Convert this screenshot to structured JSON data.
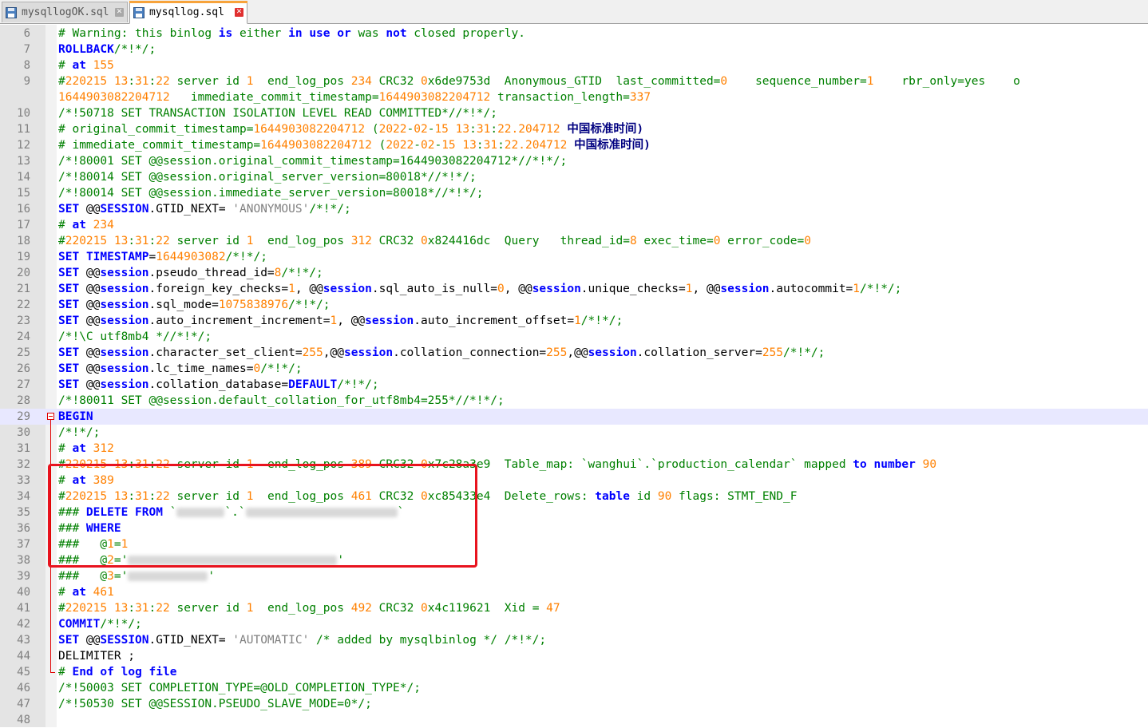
{
  "tabs": [
    {
      "label": "mysqllogOK.sql",
      "close": "✕",
      "active": false
    },
    {
      "label": "mysqllog.sql",
      "close": "✕",
      "active": true
    }
  ],
  "lines": [
    {
      "n": "6",
      "t": [
        [
          "# Warning: this binlog ",
          "cm"
        ],
        [
          "is",
          "kw"
        ],
        [
          " either ",
          "cm"
        ],
        [
          "in",
          "kw"
        ],
        [
          " ",
          "cm"
        ],
        [
          "use",
          "kw"
        ],
        [
          " ",
          "cm"
        ],
        [
          "or",
          "kw"
        ],
        [
          " was ",
          "cm"
        ],
        [
          "not",
          "kw"
        ],
        [
          " closed properly.",
          "cm"
        ]
      ]
    },
    {
      "n": "7",
      "t": [
        [
          "ROLLBACK",
          "kw"
        ],
        [
          "/*!*/;",
          "cm"
        ]
      ]
    },
    {
      "n": "8",
      "t": [
        [
          "# ",
          "cm"
        ],
        [
          "at",
          "kw"
        ],
        [
          " ",
          "cm"
        ],
        [
          "155",
          "num"
        ]
      ]
    },
    {
      "n": "9",
      "t": [
        [
          "#",
          "cm"
        ],
        [
          "220215",
          "num"
        ],
        [
          " ",
          "cm"
        ],
        [
          "13",
          "num"
        ],
        [
          ":",
          "cm"
        ],
        [
          "31",
          "num"
        ],
        [
          ":",
          "cm"
        ],
        [
          "22",
          "num"
        ],
        [
          " server id ",
          "cm"
        ],
        [
          "1",
          "num"
        ],
        [
          "  end_log_pos ",
          "cm"
        ],
        [
          "234",
          "num"
        ],
        [
          " CRC32 ",
          "cm"
        ],
        [
          "0",
          "num"
        ],
        [
          "x6de9753d  Anonymous_GTID  last_committed=",
          "cm"
        ],
        [
          "0",
          "num"
        ],
        [
          "    sequence_number=",
          "cm"
        ],
        [
          "1",
          "num"
        ],
        [
          "    rbr_only=yes    o",
          "cm"
        ]
      ]
    },
    {
      "n": "",
      "t": [
        [
          "1644903082204712",
          "num"
        ],
        [
          "   immediate_commit_timestamp=",
          "cm"
        ],
        [
          "1644903082204712",
          "num"
        ],
        [
          " transaction_length=",
          "cm"
        ],
        [
          "337",
          "num"
        ]
      ]
    },
    {
      "n": "10",
      "t": [
        [
          "/*!50718 SET TRANSACTION ISOLATION LEVEL READ COMMITTED*//*!*/;",
          "cm"
        ]
      ]
    },
    {
      "n": "11",
      "t": [
        [
          "# original_commit_timestamp=",
          "cm"
        ],
        [
          "1644903082204712",
          "num"
        ],
        [
          " (",
          "cm"
        ],
        [
          "2022",
          "num"
        ],
        [
          "-",
          "cm"
        ],
        [
          "02",
          "num"
        ],
        [
          "-",
          "cm"
        ],
        [
          "15",
          "num"
        ],
        [
          " ",
          "cm"
        ],
        [
          "13",
          "num"
        ],
        [
          ":",
          "cm"
        ],
        [
          "31",
          "num"
        ],
        [
          ":",
          "cm"
        ],
        [
          "22.204712",
          "num"
        ],
        [
          " 中国标准时间)",
          "op"
        ]
      ]
    },
    {
      "n": "12",
      "t": [
        [
          "# immediate_commit_timestamp=",
          "cm"
        ],
        [
          "1644903082204712",
          "num"
        ],
        [
          " (",
          "cm"
        ],
        [
          "2022",
          "num"
        ],
        [
          "-",
          "cm"
        ],
        [
          "02",
          "num"
        ],
        [
          "-",
          "cm"
        ],
        [
          "15",
          "num"
        ],
        [
          " ",
          "cm"
        ],
        [
          "13",
          "num"
        ],
        [
          ":",
          "cm"
        ],
        [
          "31",
          "num"
        ],
        [
          ":",
          "cm"
        ],
        [
          "22.204712",
          "num"
        ],
        [
          " 中国标准时间)",
          "op"
        ]
      ]
    },
    {
      "n": "13",
      "t": [
        [
          "/*!80001 SET @@session.original_commit_timestamp=1644903082204712*//*!*/;",
          "cm"
        ]
      ]
    },
    {
      "n": "14",
      "t": [
        [
          "/*!80014 SET @@session.original_server_version=80018*//*!*/;",
          "cm"
        ]
      ]
    },
    {
      "n": "15",
      "t": [
        [
          "/*!80014 SET @@session.immediate_server_version=80018*//*!*/;",
          "cm"
        ]
      ]
    },
    {
      "n": "16",
      "t": [
        [
          "SET",
          "kw"
        ],
        [
          " @@",
          ""
        ],
        [
          "SESSION",
          "kw"
        ],
        [
          ".GTID_NEXT= ",
          ""
        ],
        [
          "'ANONYMOUS'",
          "str"
        ],
        [
          "/*!*/;",
          "cm"
        ]
      ]
    },
    {
      "n": "17",
      "t": [
        [
          "# ",
          "cm"
        ],
        [
          "at",
          "kw"
        ],
        [
          " ",
          "cm"
        ],
        [
          "234",
          "num"
        ]
      ]
    },
    {
      "n": "18",
      "t": [
        [
          "#",
          "cm"
        ],
        [
          "220215",
          "num"
        ],
        [
          " ",
          "cm"
        ],
        [
          "13",
          "num"
        ],
        [
          ":",
          "cm"
        ],
        [
          "31",
          "num"
        ],
        [
          ":",
          "cm"
        ],
        [
          "22",
          "num"
        ],
        [
          " server id ",
          "cm"
        ],
        [
          "1",
          "num"
        ],
        [
          "  end_log_pos ",
          "cm"
        ],
        [
          "312",
          "num"
        ],
        [
          " CRC32 ",
          "cm"
        ],
        [
          "0",
          "num"
        ],
        [
          "x824416dc  Query   thread_id=",
          "cm"
        ],
        [
          "8",
          "num"
        ],
        [
          " exec_time=",
          "cm"
        ],
        [
          "0",
          "num"
        ],
        [
          " error_code=",
          "cm"
        ],
        [
          "0",
          "num"
        ]
      ]
    },
    {
      "n": "19",
      "t": [
        [
          "SET",
          "kw"
        ],
        [
          " ",
          ""
        ],
        [
          "TIMESTAMP",
          "kw"
        ],
        [
          "=",
          ""
        ],
        [
          "1644903082",
          "num"
        ],
        [
          "/*!*/;",
          "cm"
        ]
      ]
    },
    {
      "n": "20",
      "t": [
        [
          "SET",
          "kw"
        ],
        [
          " @@",
          ""
        ],
        [
          "session",
          "kw"
        ],
        [
          ".pseudo_thread_id=",
          ""
        ],
        [
          "8",
          "num"
        ],
        [
          "/*!*/;",
          "cm"
        ]
      ]
    },
    {
      "n": "21",
      "t": [
        [
          "SET",
          "kw"
        ],
        [
          " @@",
          ""
        ],
        [
          "session",
          "kw"
        ],
        [
          ".foreign_key_checks=",
          ""
        ],
        [
          "1",
          "num"
        ],
        [
          ", @@",
          ""
        ],
        [
          "session",
          "kw"
        ],
        [
          ".sql_auto_is_null=",
          ""
        ],
        [
          "0",
          "num"
        ],
        [
          ", @@",
          ""
        ],
        [
          "session",
          "kw"
        ],
        [
          ".unique_checks=",
          ""
        ],
        [
          "1",
          "num"
        ],
        [
          ", @@",
          ""
        ],
        [
          "session",
          "kw"
        ],
        [
          ".autocommit=",
          ""
        ],
        [
          "1",
          "num"
        ],
        [
          "/*!*/;",
          "cm"
        ]
      ]
    },
    {
      "n": "22",
      "t": [
        [
          "SET",
          "kw"
        ],
        [
          " @@",
          ""
        ],
        [
          "session",
          "kw"
        ],
        [
          ".sql_mode=",
          ""
        ],
        [
          "1075838976",
          "num"
        ],
        [
          "/*!*/;",
          "cm"
        ]
      ]
    },
    {
      "n": "23",
      "t": [
        [
          "SET",
          "kw"
        ],
        [
          " @@",
          ""
        ],
        [
          "session",
          "kw"
        ],
        [
          ".auto_increment_increment=",
          ""
        ],
        [
          "1",
          "num"
        ],
        [
          ", @@",
          ""
        ],
        [
          "session",
          "kw"
        ],
        [
          ".auto_increment_offset=",
          ""
        ],
        [
          "1",
          "num"
        ],
        [
          "/*!*/;",
          "cm"
        ]
      ]
    },
    {
      "n": "24",
      "t": [
        [
          "/*!\\C utf8mb4 *//*!*/;",
          "cm"
        ]
      ]
    },
    {
      "n": "25",
      "t": [
        [
          "SET",
          "kw"
        ],
        [
          " @@",
          ""
        ],
        [
          "session",
          "kw"
        ],
        [
          ".character_set_client=",
          ""
        ],
        [
          "255",
          "num"
        ],
        [
          ",@@",
          ""
        ],
        [
          "session",
          "kw"
        ],
        [
          ".collation_connection=",
          ""
        ],
        [
          "255",
          "num"
        ],
        [
          ",@@",
          ""
        ],
        [
          "session",
          "kw"
        ],
        [
          ".collation_server=",
          ""
        ],
        [
          "255",
          "num"
        ],
        [
          "/*!*/;",
          "cm"
        ]
      ]
    },
    {
      "n": "26",
      "t": [
        [
          "SET",
          "kw"
        ],
        [
          " @@",
          ""
        ],
        [
          "session",
          "kw"
        ],
        [
          ".lc_time_names=",
          ""
        ],
        [
          "0",
          "num"
        ],
        [
          "/*!*/;",
          "cm"
        ]
      ]
    },
    {
      "n": "27",
      "t": [
        [
          "SET",
          "kw"
        ],
        [
          " @@",
          ""
        ],
        [
          "session",
          "kw"
        ],
        [
          ".collation_database=",
          ""
        ],
        [
          "DEFAULT",
          "kw"
        ],
        [
          "/*!*/;",
          "cm"
        ]
      ]
    },
    {
      "n": "28",
      "t": [
        [
          "/*!80011 SET @@session.default_collation_for_utf8mb4=255*//*!*/;",
          "cm"
        ]
      ]
    },
    {
      "n": "29",
      "t": [
        [
          "BEGIN",
          "kw"
        ]
      ]
    },
    {
      "n": "30",
      "t": [
        [
          "/*!*/;",
          "cm"
        ]
      ]
    },
    {
      "n": "31",
      "t": [
        [
          "# ",
          "cm"
        ],
        [
          "at",
          "kw"
        ],
        [
          " ",
          "cm"
        ],
        [
          "312",
          "num"
        ]
      ]
    },
    {
      "n": "32",
      "t": [
        [
          "#",
          "cm"
        ],
        [
          "220215",
          "num"
        ],
        [
          " ",
          "cm"
        ],
        [
          "13",
          "num"
        ],
        [
          ":",
          "cm"
        ],
        [
          "31",
          "num"
        ],
        [
          ":",
          "cm"
        ],
        [
          "22",
          "num"
        ],
        [
          " server id ",
          "cm"
        ],
        [
          "1",
          "num"
        ],
        [
          "  end_log_pos ",
          "cm"
        ],
        [
          "389",
          "num"
        ],
        [
          " CRC32 ",
          "cm"
        ],
        [
          "0",
          "num"
        ],
        [
          "x7c28a3e9  Table_map: `wanghui`.`production_calendar` mapped ",
          "cm"
        ],
        [
          "to",
          "kw"
        ],
        [
          " ",
          "cm"
        ],
        [
          "number",
          "kw"
        ],
        [
          " ",
          "cm"
        ],
        [
          "90",
          "num"
        ]
      ]
    },
    {
      "n": "33",
      "t": [
        [
          "# ",
          "cm"
        ],
        [
          "at",
          "kw"
        ],
        [
          " ",
          "cm"
        ],
        [
          "389",
          "num"
        ]
      ]
    },
    {
      "n": "34",
      "t": [
        [
          "#",
          "cm"
        ],
        [
          "220215",
          "num"
        ],
        [
          " ",
          "cm"
        ],
        [
          "13",
          "num"
        ],
        [
          ":",
          "cm"
        ],
        [
          "31",
          "num"
        ],
        [
          ":",
          "cm"
        ],
        [
          "22",
          "num"
        ],
        [
          " server id ",
          "cm"
        ],
        [
          "1",
          "num"
        ],
        [
          "  end_log_pos ",
          "cm"
        ],
        [
          "461",
          "num"
        ],
        [
          " CRC32 ",
          "cm"
        ],
        [
          "0",
          "num"
        ],
        [
          "xc85433e4  Delete_rows: ",
          "cm"
        ],
        [
          "table",
          "kw"
        ],
        [
          " id ",
          "cm"
        ],
        [
          "90",
          "num"
        ],
        [
          " flags: STMT_END_F",
          "cm"
        ]
      ]
    },
    {
      "n": "35",
      "t": [
        [
          "### ",
          "cm"
        ],
        [
          "DELETE",
          "kw"
        ],
        [
          " ",
          "cm"
        ],
        [
          "FROM",
          "kw"
        ],
        [
          " `",
          "cm"
        ],
        [
          "#60",
          "R"
        ],
        [
          "`.`",
          "cm"
        ],
        [
          "#190",
          "R"
        ],
        [
          "`",
          "cm"
        ]
      ]
    },
    {
      "n": "36",
      "t": [
        [
          "### ",
          "cm"
        ],
        [
          "WHERE",
          "kw"
        ]
      ]
    },
    {
      "n": "37",
      "t": [
        [
          "###   @",
          "cm"
        ],
        [
          "1",
          "num"
        ],
        [
          "=",
          "cm"
        ],
        [
          "1",
          "num"
        ]
      ]
    },
    {
      "n": "38",
      "t": [
        [
          "###   @",
          "cm"
        ],
        [
          "2",
          "num"
        ],
        [
          "='",
          "cm"
        ],
        [
          "#262",
          "R"
        ],
        [
          "'",
          "cm"
        ]
      ]
    },
    {
      "n": "39",
      "t": [
        [
          "###   @",
          "cm"
        ],
        [
          "3",
          "num"
        ],
        [
          "='",
          "cm"
        ],
        [
          "#100",
          "R"
        ],
        [
          "'",
          "cm"
        ]
      ]
    },
    {
      "n": "40",
      "t": [
        [
          "# ",
          "cm"
        ],
        [
          "at",
          "kw"
        ],
        [
          " ",
          "cm"
        ],
        [
          "461",
          "num"
        ]
      ]
    },
    {
      "n": "41",
      "t": [
        [
          "#",
          "cm"
        ],
        [
          "220215",
          "num"
        ],
        [
          " ",
          "cm"
        ],
        [
          "13",
          "num"
        ],
        [
          ":",
          "cm"
        ],
        [
          "31",
          "num"
        ],
        [
          ":",
          "cm"
        ],
        [
          "22",
          "num"
        ],
        [
          " server id ",
          "cm"
        ],
        [
          "1",
          "num"
        ],
        [
          "  end_log_pos ",
          "cm"
        ],
        [
          "492",
          "num"
        ],
        [
          " CRC32 ",
          "cm"
        ],
        [
          "0",
          "num"
        ],
        [
          "x4c119621  Xid = ",
          "cm"
        ],
        [
          "47",
          "num"
        ]
      ]
    },
    {
      "n": "42",
      "t": [
        [
          "COMMIT",
          "kw"
        ],
        [
          "/*!*/;",
          "cm"
        ]
      ]
    },
    {
      "n": "43",
      "t": [
        [
          "SET",
          "kw"
        ],
        [
          " @@",
          ""
        ],
        [
          "SESSION",
          "kw"
        ],
        [
          ".GTID_NEXT= ",
          ""
        ],
        [
          "'AUTOMATIC'",
          "str"
        ],
        [
          " /* added by mysqlbinlog */ /*!*/;",
          "cm"
        ]
      ]
    },
    {
      "n": "44",
      "t": [
        [
          "DELIMITER ;",
          ""
        ]
      ]
    },
    {
      "n": "45",
      "t": [
        [
          "# ",
          "cm"
        ],
        [
          "End",
          "kw"
        ],
        [
          " ",
          "cm"
        ],
        [
          "of",
          "kw"
        ],
        [
          " ",
          "cm"
        ],
        [
          "log",
          "kw"
        ],
        [
          " ",
          "cm"
        ],
        [
          "file",
          "kw"
        ]
      ]
    },
    {
      "n": "46",
      "t": [
        [
          "/*!50003 SET COMPLETION_TYPE=@OLD_COMPLETION_TYPE*/;",
          "cm"
        ]
      ]
    },
    {
      "n": "47",
      "t": [
        [
          "/*!50530 SET @@SESSION.PSEUDO_SLAVE_MODE=0*/;",
          "cm"
        ]
      ]
    },
    {
      "n": "48",
      "t": []
    }
  ],
  "current_line": "29",
  "colors": {
    "keyword": "#0000ff",
    "number": "#ff8000",
    "comment": "#008000",
    "string": "#808080",
    "highlight_box": "#e8131e"
  }
}
